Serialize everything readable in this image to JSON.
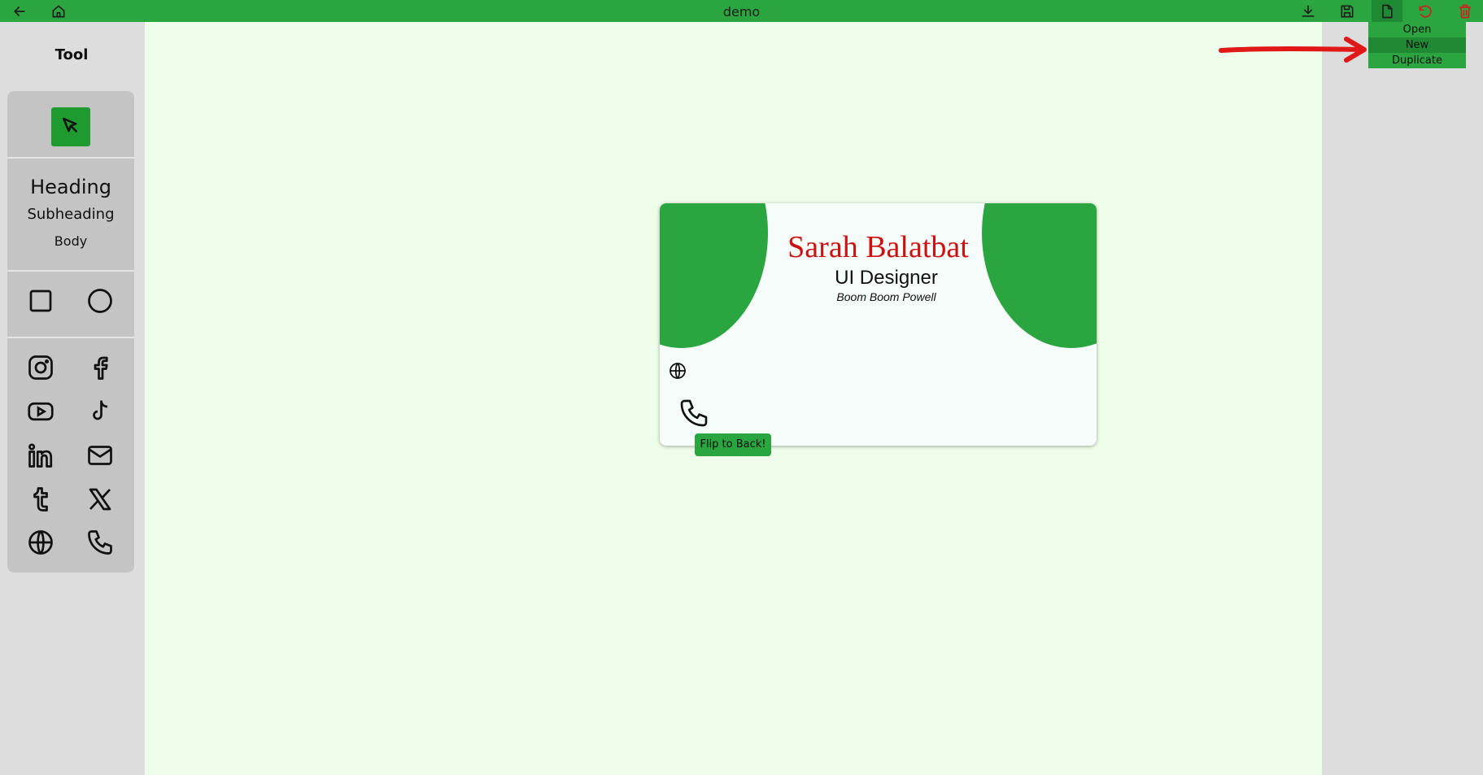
{
  "header": {
    "title": "demo",
    "icons": [
      "back-arrow-icon",
      "home-icon",
      "download-icon",
      "save-icon",
      "file-icon",
      "undo-icon",
      "trash-icon"
    ]
  },
  "file_menu": {
    "items": [
      "Open",
      "New",
      "Duplicate"
    ],
    "hovered": "New"
  },
  "sidebar": {
    "title": "Tool",
    "text_tools": {
      "heading": "Heading",
      "subheading": "Subheading",
      "body": "Body"
    },
    "shapes": [
      "square-icon",
      "circle-icon"
    ],
    "icons": [
      "instagram-icon",
      "facebook-icon",
      "youtube-icon",
      "tiktok-icon",
      "linkedin-icon",
      "mail-icon",
      "tumblr-icon",
      "x-icon",
      "globe-icon",
      "phone-icon"
    ]
  },
  "card": {
    "name": "Sarah Balatbat",
    "role": "UI Designer",
    "tagline": "Boom Boom Powell",
    "accent_color": "#2aa53f",
    "name_color": "#cc1111"
  },
  "flip_button": "Flip to Back!",
  "colors": {
    "topbar": "#2aa53f",
    "canvas": "#effeea",
    "panel": "#c4c4c4",
    "annotation_arrow": "#e01818"
  }
}
